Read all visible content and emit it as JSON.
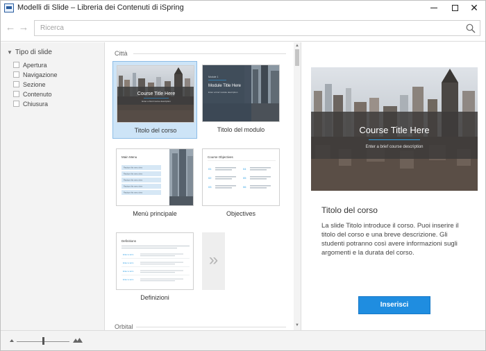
{
  "window": {
    "title": "Modelli di Slide – Libreria dei Contenuti di iSpring",
    "minimize_icon": "minimize-icon",
    "maximize_icon": "maximize-icon",
    "close_glyph": "✕"
  },
  "toolbar": {
    "back_glyph": "←",
    "forward_glyph": "→",
    "search_placeholder": "Ricerca",
    "search_value": ""
  },
  "filters": {
    "heading": "Tipo di slide",
    "items": [
      {
        "label": "Apertura",
        "checked": false
      },
      {
        "label": "Navigazione",
        "checked": false
      },
      {
        "label": "Sezione",
        "checked": false
      },
      {
        "label": "Contenuto",
        "checked": false
      },
      {
        "label": "Chiusura",
        "checked": false
      }
    ]
  },
  "gallery": {
    "groups": [
      {
        "label": "Città"
      },
      {
        "label": "Orbital"
      }
    ],
    "cards": [
      {
        "label": "Titolo del corso",
        "selected": true,
        "thumb": {
          "title": "Course Title Here",
          "subtitle": "Enter a brief course description"
        }
      },
      {
        "label": "Titolo del modulo",
        "selected": false,
        "thumb": {
          "overline": "Module 1",
          "title": "Module Title Here",
          "subtitle": "Enter a brief module description"
        }
      },
      {
        "label": "Menù principale",
        "selected": false,
        "thumb": {
          "title": "Main Menu",
          "item": "Replace this menu item"
        }
      },
      {
        "label": "Objectives",
        "selected": false,
        "thumb": {
          "title": "Course Objectives",
          "numbers": [
            "01",
            "02",
            "03",
            "04",
            "05",
            "06"
          ]
        }
      },
      {
        "label": "Definizioni",
        "selected": false,
        "thumb": {
          "title": "Definitions",
          "term": "Enter a term"
        }
      }
    ],
    "more_glyph": "»"
  },
  "preview": {
    "image": {
      "title": "Course Title Here",
      "subtitle": "Enter a brief course description"
    },
    "title": "Titolo del corso",
    "description": "La slide Titolo introduce il corso. Puoi inserire il titolo del corso e una breve descrizione. Gli studenti potranno così avere informazioni sugli argomenti e la durata del corso.",
    "insert_label": "Inserisci"
  },
  "zoom": {
    "level": 0.5
  },
  "colors": {
    "accent": "#1f8de0",
    "selection": "#cde4f7",
    "panel": "#f3f3f3"
  }
}
